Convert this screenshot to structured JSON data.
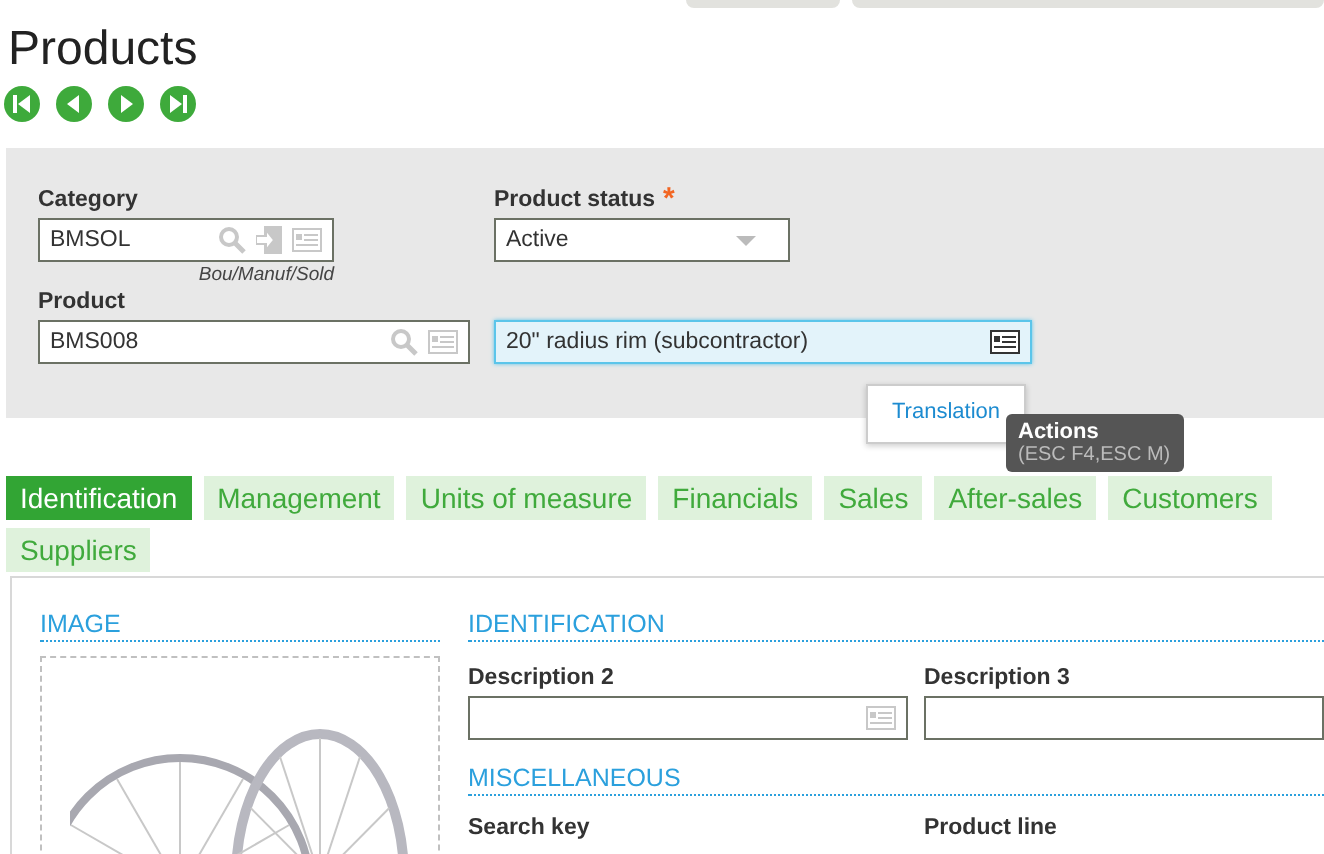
{
  "page": {
    "title": "Products"
  },
  "record_nav": [
    {
      "kind": "first"
    },
    {
      "kind": "previous"
    },
    {
      "kind": "next"
    },
    {
      "kind": "last"
    }
  ],
  "header_form": {
    "category": {
      "label": "Category",
      "value": "BMSOL",
      "caption": "Bou/Manuf/Sold"
    },
    "product_status": {
      "label": "Product status",
      "required_mark": "*",
      "value": "Active"
    },
    "product": {
      "label": "Product",
      "value": "BMS008"
    },
    "description": {
      "value": "20\" radius rim (subcontractor)",
      "focused": true
    }
  },
  "actions_menu": {
    "items": [
      {
        "label": "Translation"
      }
    ]
  },
  "tooltip": {
    "title": "Actions",
    "shortcut": "(ESC F4,ESC M)"
  },
  "tabs": [
    {
      "label": "Identification",
      "selected": true
    },
    {
      "label": "Management",
      "selected": false
    },
    {
      "label": "Units of measure",
      "selected": false
    },
    {
      "label": "Financials",
      "selected": false
    },
    {
      "label": "Sales",
      "selected": false
    },
    {
      "label": "After-sales",
      "selected": false
    },
    {
      "label": "Customers",
      "selected": false
    },
    {
      "label": "Suppliers",
      "selected": false
    }
  ],
  "sections": {
    "image": {
      "title": "IMAGE"
    },
    "identification": {
      "title": "IDENTIFICATION",
      "fields": [
        {
          "label": "Description 2",
          "kind": "text_detail"
        },
        {
          "label": "Description 3",
          "kind": "text"
        }
      ]
    },
    "miscellaneous": {
      "title": "MISCELLANEOUS",
      "labels": [
        "Search key",
        "Product line"
      ]
    }
  }
}
